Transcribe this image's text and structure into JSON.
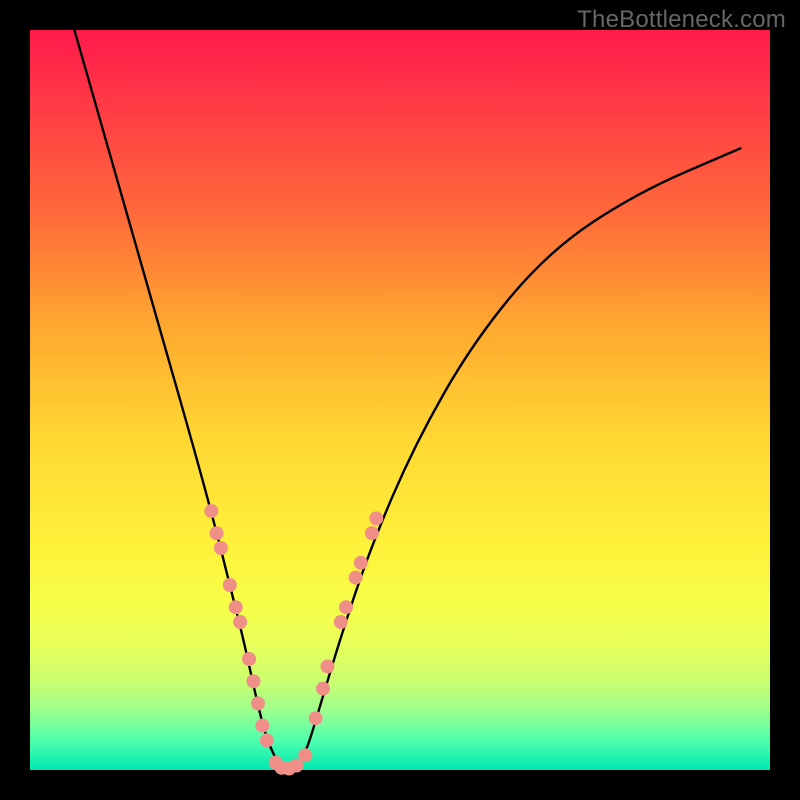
{
  "attribution": "TheBottleneck.com",
  "chart_data": {
    "type": "line",
    "title": "",
    "xlabel": "",
    "ylabel": "",
    "xlim": [
      0,
      100
    ],
    "ylim": [
      0,
      100
    ],
    "grid": false,
    "legend": false,
    "series": [
      {
        "name": "bottleneck-curve",
        "x": [
          6,
          10,
          14,
          18,
          22,
          25,
          27,
          29,
          30.5,
          32,
          34,
          36,
          37.5,
          39,
          42,
          46,
          52,
          60,
          70,
          82,
          96
        ],
        "y": [
          100,
          86,
          72,
          58,
          44,
          33,
          25,
          17,
          10,
          4,
          0,
          0,
          3,
          8,
          18,
          30,
          44,
          58,
          70,
          78,
          84
        ]
      }
    ],
    "markers": {
      "comment": "salmon-colored data point markers clustered near the valley of the curve",
      "points": [
        {
          "x": 24.5,
          "y": 35
        },
        {
          "x": 25.2,
          "y": 32
        },
        {
          "x": 25.8,
          "y": 30
        },
        {
          "x": 27.0,
          "y": 25
        },
        {
          "x": 27.8,
          "y": 22
        },
        {
          "x": 28.4,
          "y": 20
        },
        {
          "x": 29.6,
          "y": 15
        },
        {
          "x": 30.2,
          "y": 12
        },
        {
          "x": 30.8,
          "y": 9
        },
        {
          "x": 31.4,
          "y": 6
        },
        {
          "x": 32.0,
          "y": 4
        },
        {
          "x": 33.2,
          "y": 1
        },
        {
          "x": 34.0,
          "y": 0.3
        },
        {
          "x": 35.0,
          "y": 0.2
        },
        {
          "x": 36.0,
          "y": 0.6
        },
        {
          "x": 37.2,
          "y": 2
        },
        {
          "x": 38.6,
          "y": 7
        },
        {
          "x": 39.6,
          "y": 11
        },
        {
          "x": 40.2,
          "y": 14
        },
        {
          "x": 42.0,
          "y": 20
        },
        {
          "x": 42.7,
          "y": 22
        },
        {
          "x": 44.0,
          "y": 26
        },
        {
          "x": 44.7,
          "y": 28
        },
        {
          "x": 46.2,
          "y": 32
        },
        {
          "x": 46.8,
          "y": 34
        }
      ],
      "radius_px": 7
    },
    "background": {
      "type": "vertical-gradient",
      "stops": [
        {
          "pos": 0.0,
          "color": "#ff1a4c"
        },
        {
          "pos": 0.25,
          "color": "#ff6a3a"
        },
        {
          "pos": 0.55,
          "color": "#ffd732"
        },
        {
          "pos": 0.8,
          "color": "#f0ff50"
        },
        {
          "pos": 1.0,
          "color": "#00e8b0"
        }
      ]
    }
  }
}
